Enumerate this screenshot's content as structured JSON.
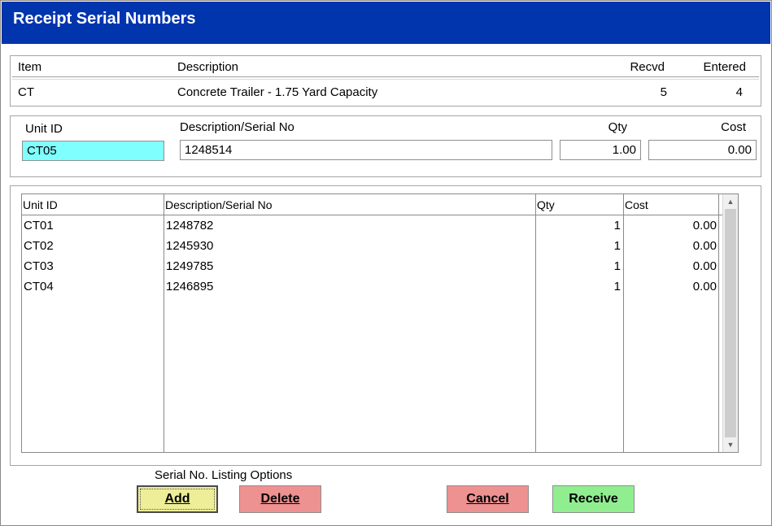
{
  "window": {
    "title": "Receipt Serial Numbers"
  },
  "item_header": {
    "col_item": "Item",
    "col_description": "Description",
    "col_recvd": "Recvd",
    "col_entered": "Entered",
    "item": "CT",
    "description": "Concrete Trailer - 1.75 Yard Capacity",
    "recvd": "5",
    "entered": "4"
  },
  "entry": {
    "label_unit_id": "Unit ID",
    "label_description": "Description/Serial No",
    "label_qty": "Qty",
    "label_cost": "Cost",
    "unit_id": "CT05",
    "description": "1248514",
    "qty": "1.00",
    "cost": "0.00"
  },
  "grid": {
    "columns": [
      "Unit ID",
      "Description/Serial No",
      "Qty",
      "Cost"
    ],
    "rows": [
      {
        "unit_id": "CT01",
        "description": "1248782",
        "qty": "1",
        "cost": "0.00"
      },
      {
        "unit_id": "CT02",
        "description": "1245930",
        "qty": "1",
        "cost": "0.00"
      },
      {
        "unit_id": "CT03",
        "description": "1249785",
        "qty": "1",
        "cost": "0.00"
      },
      {
        "unit_id": "CT04",
        "description": "1246895",
        "qty": "1",
        "cost": "0.00"
      }
    ]
  },
  "options": {
    "label": "Serial No. Listing Options",
    "add": "Add",
    "delete": "Delete",
    "cancel": "Cancel",
    "receive": "Receive"
  },
  "colors": {
    "title_bar": "#0035ad",
    "unit_id_field": "#80ffff",
    "add_button": "#eeee99",
    "delete_button": "#ee9191",
    "cancel_button": "#ee9191",
    "receive_button": "#90ee90"
  },
  "icons": {
    "scroll_up": "chevron-up-icon",
    "scroll_down": "chevron-down-icon"
  }
}
